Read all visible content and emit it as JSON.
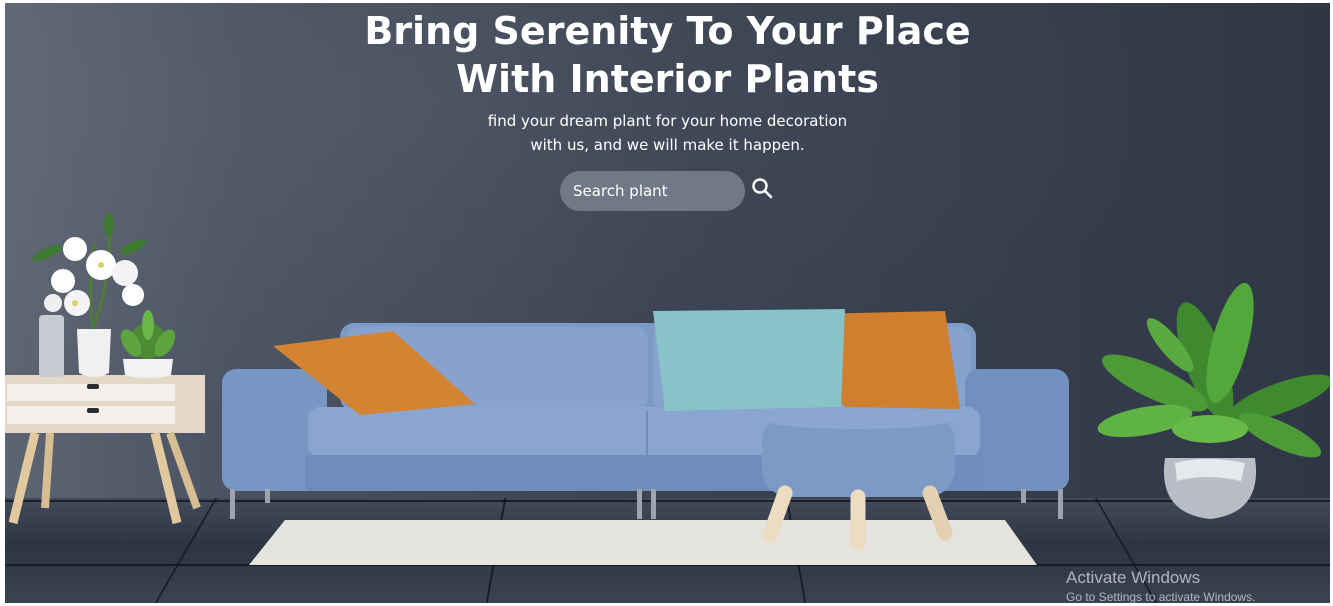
{
  "hero": {
    "title_line1": "Bring Serenity To Your Place",
    "title_line2": "With Interior Plants",
    "subtitle_line1": "find your dream plant for your home decoration",
    "subtitle_line2": "with us, and we will make it happen."
  },
  "search": {
    "placeholder": "Search plant",
    "icon": "search-icon"
  },
  "windows_watermark": {
    "title": "Activate Windows",
    "subtitle": "Go to Settings to activate Windows."
  },
  "colors": {
    "wall": "#3a4252",
    "sofa": "#7f9bc7",
    "search_field": "#717986",
    "pillow_orange": "#d0832f",
    "pillow_teal": "#86c2c9"
  }
}
